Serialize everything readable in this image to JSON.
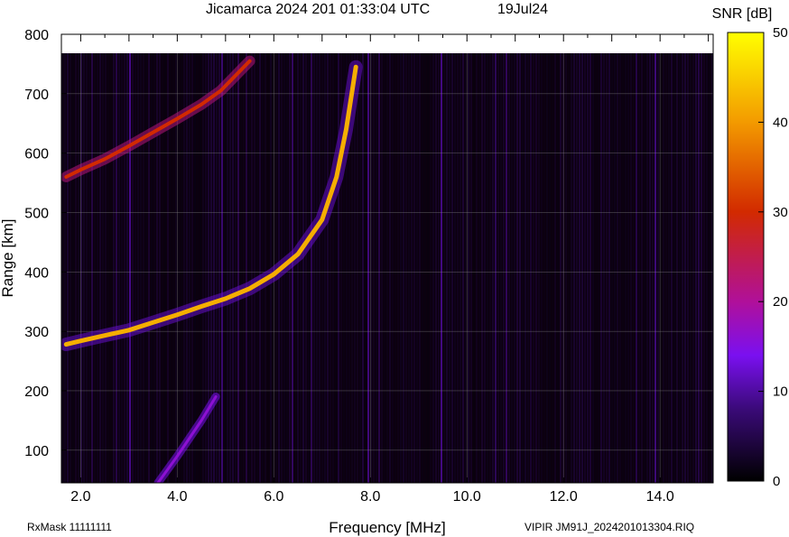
{
  "header": {
    "title": "Jicamarca 2024 201 01:33:04 UTC",
    "date": "19Jul24"
  },
  "footer": {
    "rxmask": "RxMask 11111111",
    "file": "VIPIR  JM91J_2024201013304.RIQ"
  },
  "chart_data": {
    "type": "heatmap",
    "title": "Jicamarca 2024 201 01:33:04 UTC",
    "subtitle": "19Jul24",
    "xlabel": "Frequency [MHz]",
    "ylabel": "Range [km]",
    "xlim": [
      1.6,
      15.1
    ],
    "ylim": [
      45,
      800
    ],
    "xticks": [
      2.0,
      4.0,
      6.0,
      8.0,
      10.0,
      12.0,
      14.0
    ],
    "xtick_labels": [
      "2.0",
      "4.0",
      "6.0",
      "8.0",
      "10.0",
      "12.0",
      "14.0"
    ],
    "yticks": [
      100,
      200,
      300,
      400,
      500,
      600,
      700,
      800
    ],
    "ytick_labels": [
      "100",
      "200",
      "300",
      "400",
      "500",
      "600",
      "700",
      "800"
    ],
    "grid": true,
    "colorbar": {
      "label": "SNR [dB]",
      "range": [
        0,
        50
      ],
      "ticks": [
        0,
        10,
        20,
        30,
        40,
        50
      ],
      "tick_labels": [
        "0",
        "10",
        "20",
        "30",
        "40",
        "50"
      ],
      "stops": [
        {
          "value": 0,
          "color": "#000000"
        },
        {
          "value": 8,
          "color": "#3a0a78"
        },
        {
          "value": 14,
          "color": "#7a10f0"
        },
        {
          "value": 20,
          "color": "#b0109a"
        },
        {
          "value": 30,
          "color": "#d22a00"
        },
        {
          "value": 40,
          "color": "#f39a00"
        },
        {
          "value": 50,
          "color": "#ffff00"
        }
      ]
    },
    "series": [
      {
        "points": [
          [
            1.7,
            278
          ],
          [
            2.0,
            284
          ],
          [
            2.5,
            293
          ],
          [
            3.0,
            302
          ],
          [
            3.5,
            315
          ],
          [
            4.0,
            328
          ],
          [
            4.5,
            342
          ],
          [
            5.0,
            355
          ],
          [
            5.5,
            372
          ],
          [
            6.0,
            396
          ],
          [
            6.5,
            430
          ],
          [
            7.0,
            488
          ],
          [
            7.3,
            560
          ],
          [
            7.5,
            640
          ],
          [
            7.7,
            745
          ]
        ]
      },
      {
        "points": [
          [
            1.7,
            560
          ],
          [
            2.0,
            572
          ],
          [
            2.5,
            590
          ],
          [
            3.0,
            612
          ],
          [
            3.5,
            635
          ],
          [
            4.0,
            658
          ],
          [
            4.5,
            682
          ],
          [
            4.9,
            705
          ],
          [
            5.5,
            755
          ]
        ]
      },
      {
        "points": [
          [
            3.6,
            45
          ],
          [
            4.0,
            90
          ],
          [
            4.5,
            150
          ],
          [
            4.8,
            190
          ]
        ]
      }
    ]
  }
}
